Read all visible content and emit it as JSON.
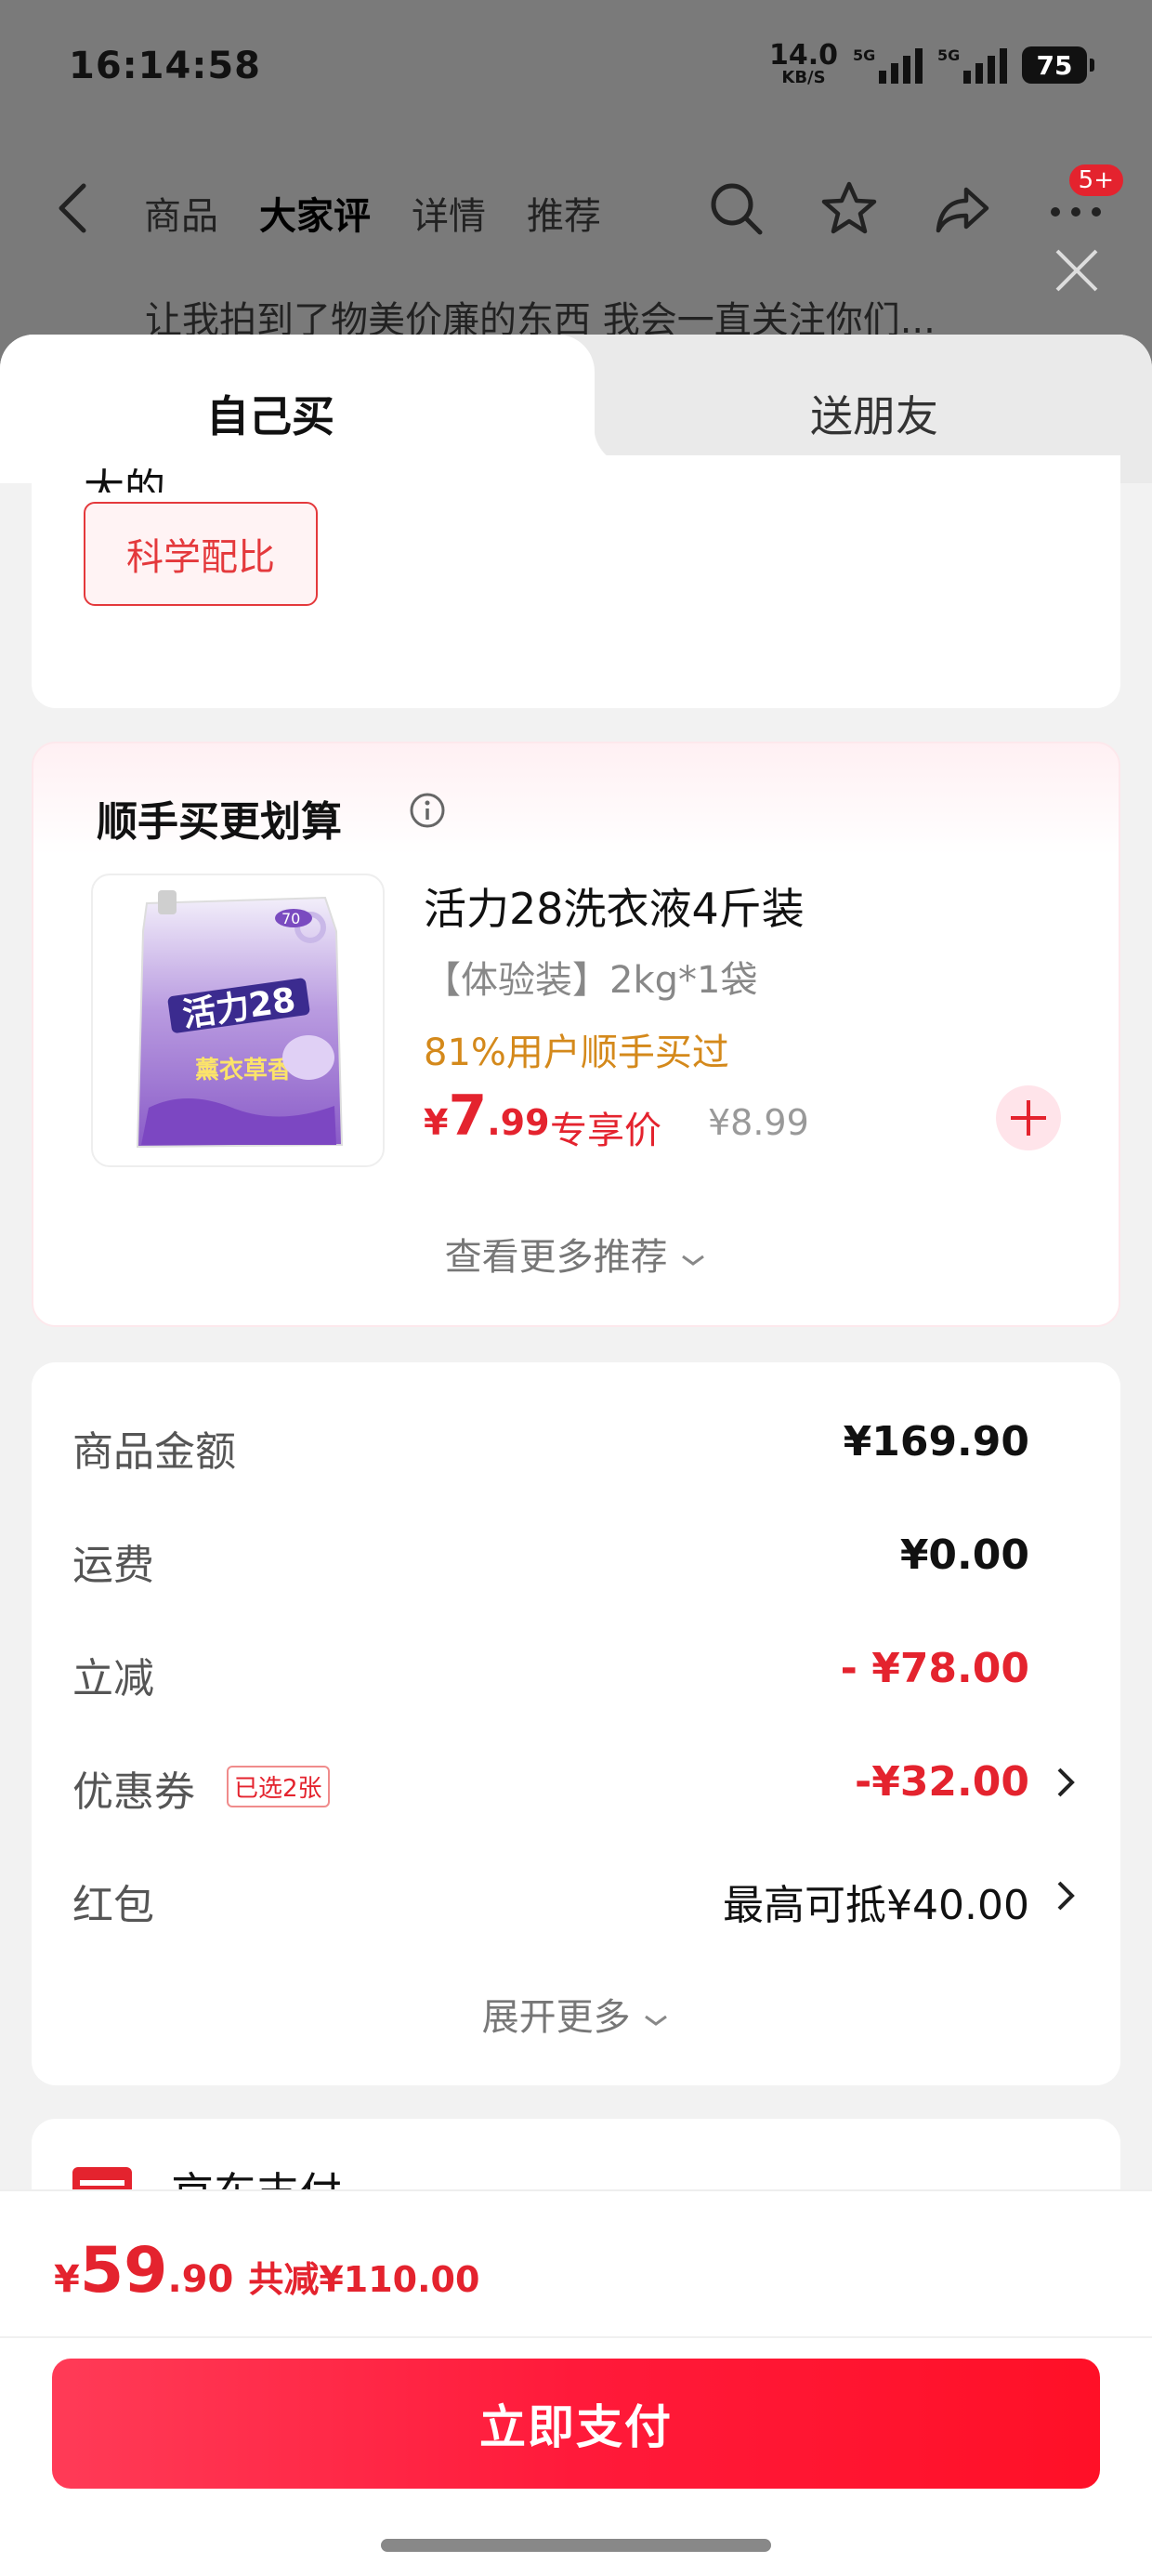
{
  "status_bar": {
    "time": "16:14:58",
    "net_speed": "14.0",
    "net_unit": "KB/S",
    "signal1_label": "5G",
    "signal2_label": "5G",
    "battery": "75"
  },
  "nav": {
    "tabs": [
      "商品",
      "大家评",
      "详情",
      "推荐"
    ],
    "active_tab": "大家评",
    "badge": "5+",
    "icons": [
      "back-icon",
      "search-icon",
      "star-icon",
      "share-icon",
      "more-icon",
      "close-icon"
    ]
  },
  "background_review": "让我拍到了物美价廉的东西 我会一直关注你们...",
  "sheet": {
    "tabs": {
      "self": "自己买",
      "friend": "送朋友"
    },
    "cut_text": "大的",
    "tag": "科学配比"
  },
  "addon": {
    "title": "顺手买更划算",
    "product": {
      "name": "活力28洗衣液4斤装",
      "spec": "【体验装】2kg*1袋",
      "bought": "81%用户顺手买过",
      "price_currency": "¥",
      "price_int": "7",
      "price_dec": ".99",
      "exclusive": "专享价",
      "original_price": "¥8.99",
      "package_brand": "活力28",
      "package_sub": "薰衣草香",
      "package_badge": "70"
    },
    "view_more": "查看更多推荐"
  },
  "summary": {
    "rows": [
      {
        "label": "商品金额",
        "value": "¥169.90"
      },
      {
        "label": "运费",
        "value": "¥0.00"
      },
      {
        "label": "立减",
        "value": "- ¥78.00"
      },
      {
        "label": "优惠券",
        "tag": "已选2张",
        "value": "-¥32.00"
      },
      {
        "label": "红包",
        "value": "最高可抵¥40.00"
      }
    ],
    "expand_more": "展开更多"
  },
  "payment": {
    "method": "京东支付"
  },
  "footer": {
    "total_currency": "¥",
    "total_int": "59",
    "total_dec": ".90",
    "saved": "共减¥110.00",
    "pay_button": "立即支付"
  },
  "colors": {
    "accent": "#e4232e",
    "orange": "#d4891b",
    "pay_gradient_start": "#ff3b57",
    "pay_gradient_end": "#ff1027"
  }
}
